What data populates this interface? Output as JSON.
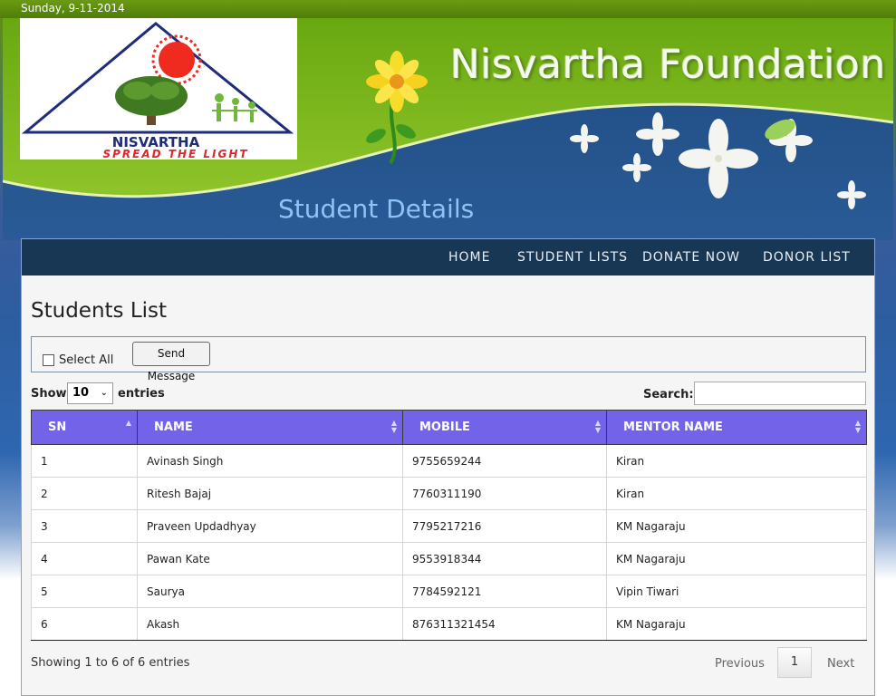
{
  "topbar": {
    "date": "Sunday, 9-11-2014"
  },
  "header": {
    "site_title": "Nisvartha Foundation",
    "page_heading": "Student Details",
    "logo": {
      "name": "NISVARTHA",
      "tagline": "SPREAD THE LIGHT"
    }
  },
  "nav": {
    "items": [
      {
        "label": "HOME"
      },
      {
        "label": "STUDENT LISTS"
      },
      {
        "label": "DONATE NOW"
      },
      {
        "label": "DONOR LIST"
      }
    ]
  },
  "main": {
    "title": "Students List",
    "select_all_label": "Select All",
    "send_message_label": "Send Message",
    "show_label": "Show",
    "entries_value": "10",
    "entries_label": "entries",
    "search_label": "Search:",
    "search_value": "",
    "table": {
      "headers": [
        "SN",
        "NAME",
        "MOBILE",
        "MENTOR NAME"
      ],
      "rows": [
        [
          "1",
          "Avinash Singh",
          "9755659244",
          "Kiran"
        ],
        [
          "2",
          "Ritesh Bajaj",
          "7760311190",
          "Kiran"
        ],
        [
          "3",
          "Praveen Updadhyay",
          "7795217216",
          "KM Nagaraju"
        ],
        [
          "4",
          "Pawan Kate",
          "9553918344",
          "KM Nagaraju"
        ],
        [
          "5",
          "Saurya",
          "7784592121",
          "Vipin Tiwari"
        ],
        [
          "6",
          "Akash",
          "876311321454",
          "KM Nagaraju"
        ]
      ]
    },
    "footer": {
      "info": "Showing 1 to 6 of 6 entries",
      "previous": "Previous",
      "page": "1",
      "next": "Next"
    }
  },
  "colors": {
    "header_green": "#7ab317",
    "nav_bg": "#173755",
    "table_header": "#7263e8",
    "heading_blue": "#8ec3f4"
  },
  "icons": [
    "flower-icon",
    "sun-icon",
    "tree-icon",
    "sort-icon",
    "chevron-down-icon"
  ]
}
